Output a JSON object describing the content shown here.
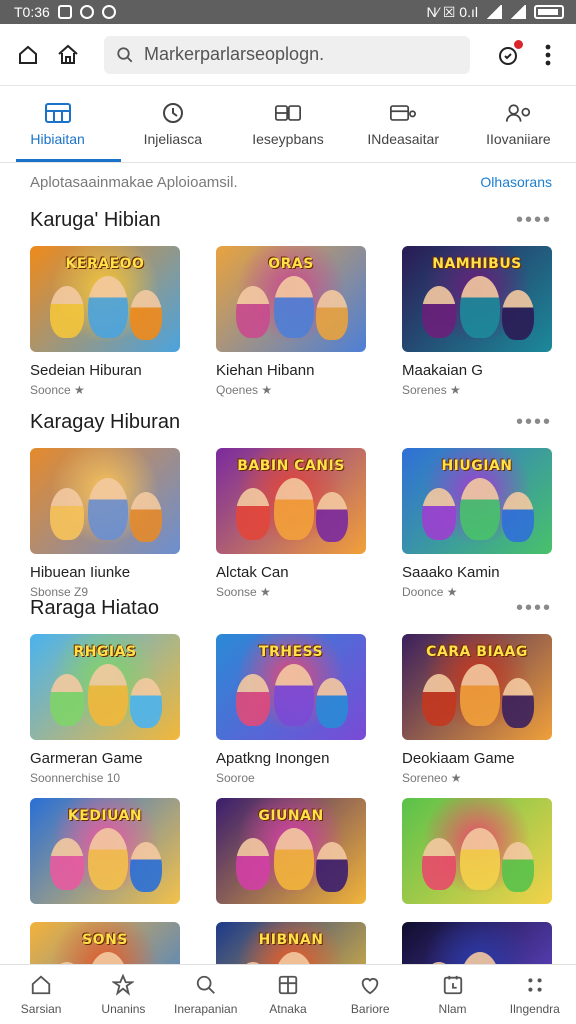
{
  "status_bar": {
    "time": "T0:36",
    "right_text": "N⁄ ☒ 0.ıl"
  },
  "search": {
    "text": "Markerparlarseoplogn."
  },
  "tabs": [
    {
      "label": "Hibiaitan",
      "icon": "grid-icon",
      "active": true
    },
    {
      "label": "Injeliasca",
      "icon": "clock-icon"
    },
    {
      "label": "Ieseypbans",
      "icon": "cards-icon"
    },
    {
      "label": "INdeasaitar",
      "icon": "layout-icon"
    },
    {
      "label": "IIovaniiare",
      "icon": "person-icon"
    }
  ],
  "subheader": {
    "text": "Aplotasaainmakae Aploioamsil.",
    "link": "Olhasorans"
  },
  "sections": [
    {
      "title": "Karuga' Hibian",
      "cards": [
        {
          "title": "Sedeian Hiburan",
          "sub": "Soonce ★",
          "thumb_label": "KERAEOO",
          "colors": [
            "#f08a1a",
            "#f4c53b",
            "#4aa3df"
          ]
        },
        {
          "title": "Kiehan Hibann",
          "sub": "Qoenes ★",
          "thumb_label": "ORAS",
          "colors": [
            "#e9a33e",
            "#c94b8e",
            "#4d7fd6"
          ]
        },
        {
          "title": "Maakaian G",
          "sub": "Sorenes ★",
          "thumb_label": "NAMHIBUS",
          "colors": [
            "#2b1a55",
            "#6a1f7a",
            "#1c8a9a"
          ]
        }
      ]
    },
    {
      "title": "Karagay Hiburan",
      "cards": [
        {
          "title": "Hibuean Iiunke",
          "sub": "Sbonse Z9",
          "thumb_label": "",
          "colors": [
            "#e58a2b",
            "#f7c35a",
            "#6b8fd1"
          ]
        },
        {
          "title": "Alctak Can",
          "sub": "Soonse ★",
          "thumb_label": "BABIN CANIS",
          "colors": [
            "#7a2a9e",
            "#e2463a",
            "#f2a13a"
          ]
        },
        {
          "title": "Saaako Kamin",
          "sub": "Doonce ★",
          "thumb_label": "HIUGIAN",
          "colors": [
            "#2f6fd8",
            "#9d3fd0",
            "#48c26a"
          ]
        }
      ]
    },
    {
      "title": "Raraga Hiatao",
      "cards": [
        {
          "title": "Garmeran Game",
          "sub": "Soonnerchise 10",
          "thumb_label": "RHGIAS",
          "colors": [
            "#4ab3ef",
            "#7fd36a",
            "#f2b73a"
          ]
        },
        {
          "title": "Apatkng Inongen",
          "sub": "Sooroe",
          "thumb_label": "TRHESS",
          "colors": [
            "#2a8ad6",
            "#e04a7a",
            "#7a4ad6"
          ]
        },
        {
          "title": "Deokiaam Game",
          "sub": "Soreneo ★",
          "thumb_label": "CARA BIAAG",
          "colors": [
            "#3a1f5e",
            "#c4371f",
            "#f0a03a"
          ]
        }
      ]
    },
    {
      "title": "",
      "cards": [
        {
          "title": "",
          "sub": "",
          "thumb_label": "KEDIUAN",
          "colors": [
            "#2a6fd6",
            "#e85aa0",
            "#f3c14a"
          ]
        },
        {
          "title": "",
          "sub": "",
          "thumb_label": "GIUNAN",
          "colors": [
            "#3a1d6e",
            "#d23fa5",
            "#f2b53a"
          ]
        },
        {
          "title": "",
          "sub": "",
          "thumb_label": "",
          "colors": [
            "#58c24a",
            "#e84a6a",
            "#f4d24a"
          ]
        }
      ]
    },
    {
      "title": "",
      "cards": [
        {
          "title": "",
          "sub": "",
          "thumb_label": "SONS",
          "colors": [
            "#f3b23a",
            "#e25a2a",
            "#3a7fd6"
          ]
        },
        {
          "title": "",
          "sub": "",
          "thumb_label": "HIBNAN",
          "colors": [
            "#1c3a8a",
            "#e85a2a",
            "#f2c23a"
          ]
        },
        {
          "title": "",
          "sub": "",
          "thumb_label": "",
          "colors": [
            "#0e0e2e",
            "#2a3aa8",
            "#6a4ad6"
          ]
        }
      ]
    }
  ],
  "bottom_nav": [
    {
      "label": "Sarsian",
      "icon": "home-icon"
    },
    {
      "label": "Unanins",
      "icon": "star-icon"
    },
    {
      "label": "Inerapanian",
      "icon": "search-icon"
    },
    {
      "label": "Atnaka",
      "icon": "box-icon"
    },
    {
      "label": "Bariore",
      "icon": "heart-icon"
    },
    {
      "label": "Nlam",
      "icon": "calendar-icon"
    },
    {
      "label": "Ilngendra",
      "icon": "more-icon"
    }
  ],
  "colors": {
    "accent": "#1a73c8",
    "status_bar": "#5f5f5f",
    "notification": "#d9262b"
  }
}
